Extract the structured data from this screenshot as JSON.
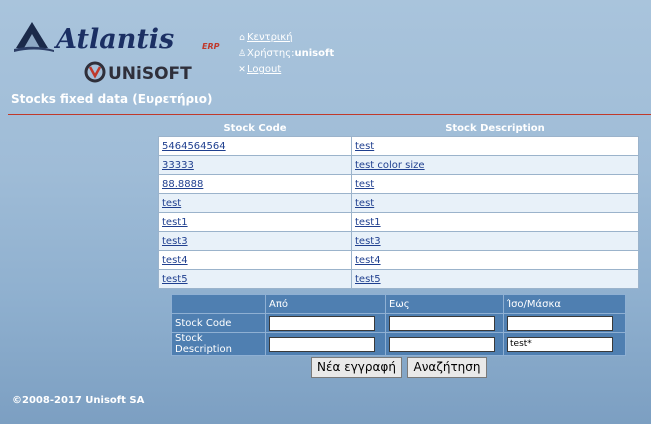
{
  "brand": {
    "name": "Atlantis",
    "suffix": "ERP",
    "vendor": "UNiSOFT"
  },
  "nav": {
    "home_label": "Κεντρική",
    "user_prefix": "Χρήστης:",
    "user_name": "unisoft",
    "logout_label": "Logout"
  },
  "page": {
    "title": "Stocks fixed data (Ευρετήριο)"
  },
  "results": {
    "columns": [
      "Stock Code",
      "Stock Description"
    ],
    "rows": [
      {
        "code": "5464564564",
        "description": "test"
      },
      {
        "code": "33333",
        "description": "test color size"
      },
      {
        "code": "88.8888",
        "description": "test"
      },
      {
        "code": "test",
        "description": "test"
      },
      {
        "code": "test1",
        "description": "test1"
      },
      {
        "code": "test3",
        "description": "test3"
      },
      {
        "code": "test4",
        "description": "test4"
      },
      {
        "code": "test5",
        "description": "test5"
      }
    ]
  },
  "filter": {
    "headers": {
      "from": "Από",
      "to": "Εως",
      "equal": "Ίσο/Μάσκα"
    },
    "rows": [
      {
        "label": "Stock Code",
        "from": "",
        "to": "",
        "equal": ""
      },
      {
        "label": "Stock Description",
        "from": "",
        "to": "",
        "equal": "test*"
      }
    ]
  },
  "buttons": {
    "new_record": "Νέα εγγραφή",
    "search": "Αναζήτηση"
  },
  "footer": {
    "copyright": "©2008-2017 Unisoft SA"
  },
  "colors": {
    "title_rule": "#c0392b",
    "filter_bg": "#4f7fb1",
    "link": "#1f3f8f",
    "row_alt": "#e8f1f9"
  }
}
